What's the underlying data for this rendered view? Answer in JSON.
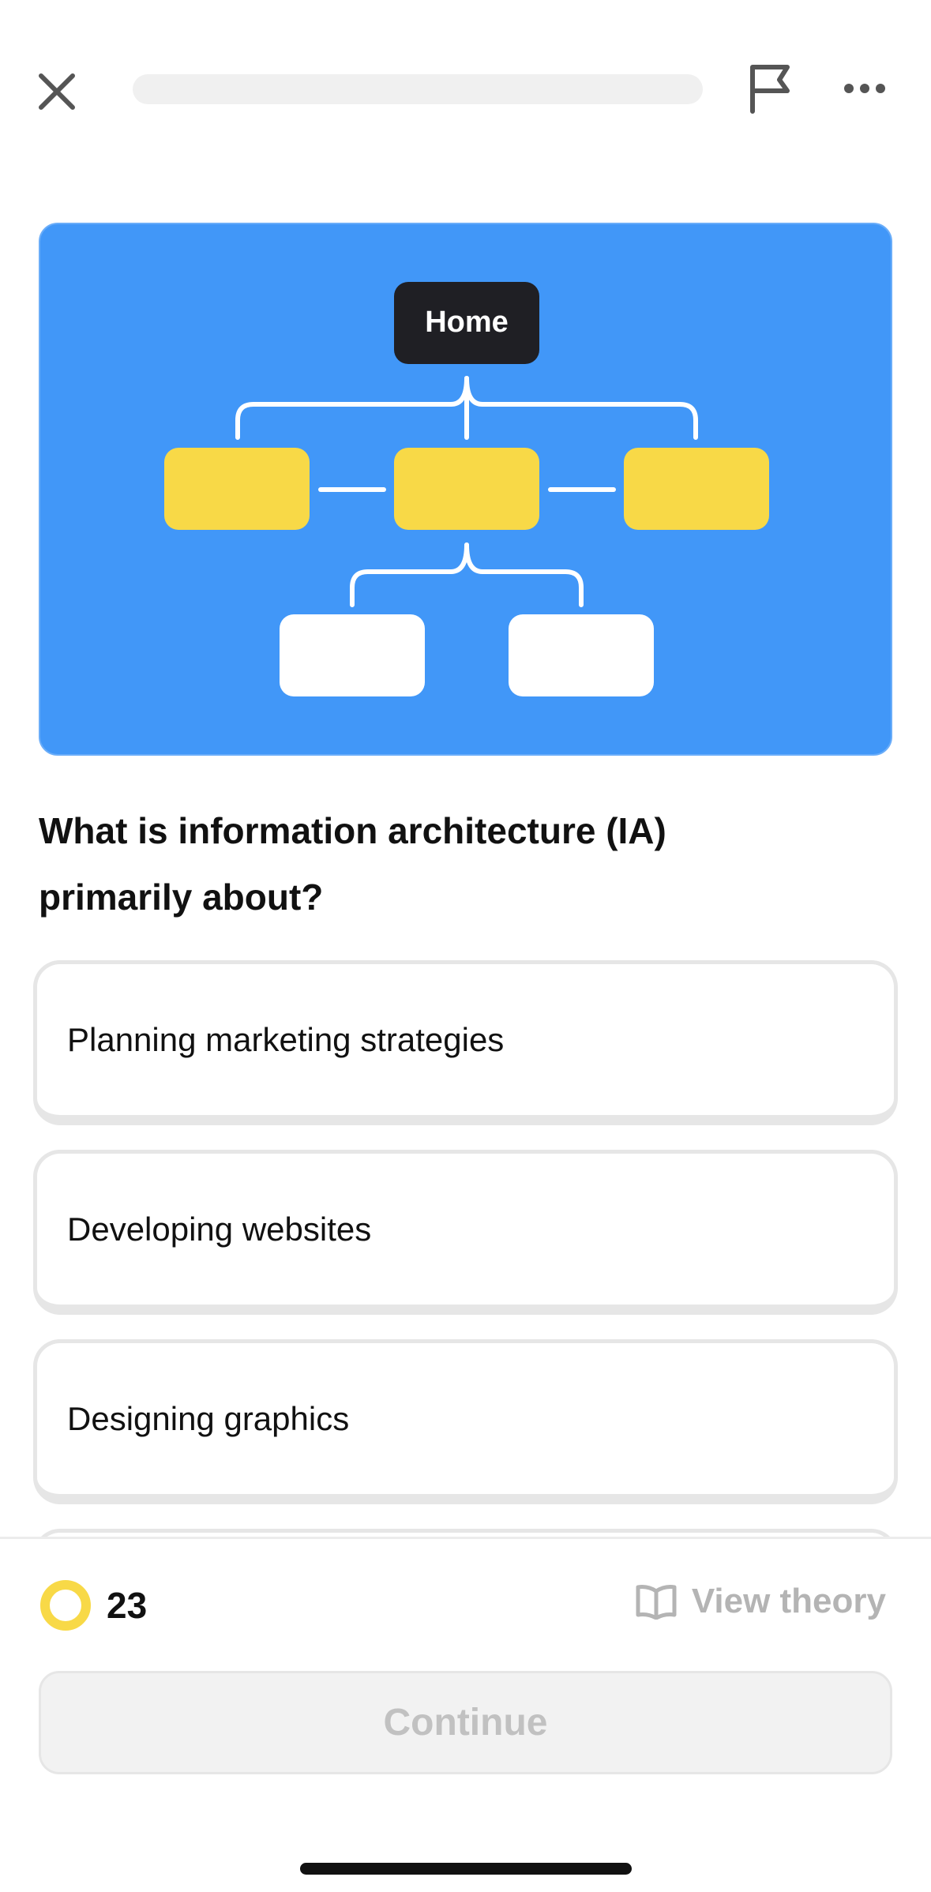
{
  "header": {
    "progress_percent": 0,
    "close_icon": "close-icon",
    "flag_icon": "flag-icon",
    "more_icon": "more-icon"
  },
  "illustration": {
    "root_label": "Home",
    "colors": {
      "background": "#4197f8",
      "root": "#1f1f24",
      "level1": "#f8d947",
      "level2": "#ffffff",
      "lines": "#ffffff"
    }
  },
  "question": {
    "text": "What is information architecture (IA) primarily about?"
  },
  "options": [
    {
      "label": "Planning marketing strategies"
    },
    {
      "label": "Developing websites"
    },
    {
      "label": "Designing graphics"
    }
  ],
  "footer": {
    "streak_count": "23",
    "streak_icon": "streak-ring-icon",
    "view_theory_label": "View theory",
    "view_theory_icon": "book-icon",
    "continue_label": "Continue",
    "colors": {
      "accent": "#f8d947",
      "disabled_text": "#c1c1c1"
    }
  }
}
